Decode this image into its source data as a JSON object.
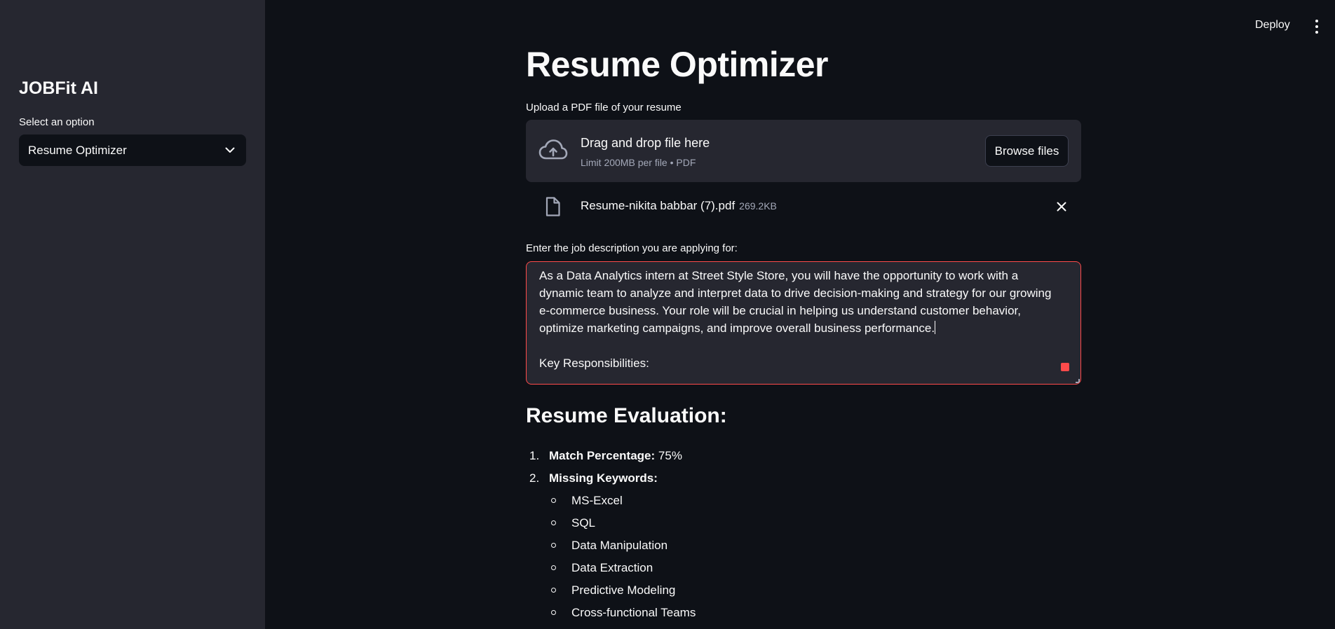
{
  "sidebar": {
    "title": "JOBFit AI",
    "select_label": "Select an option",
    "select_value": "Resume Optimizer"
  },
  "header": {
    "deploy_label": "Deploy"
  },
  "main": {
    "title": "Resume Optimizer",
    "upload": {
      "label": "Upload a PDF file of your resume",
      "drop_title": "Drag and drop file here",
      "drop_subtitle": "Limit 200MB per file • PDF",
      "browse_label": "Browse files"
    },
    "file": {
      "name": "Resume-nikita babbar (7).pdf",
      "size": "269.2KB"
    },
    "job_description": {
      "label": "Enter the job description you are applying for:",
      "paragraph": "As a Data Analytics intern at Street Style Store, you will have the opportunity to work with a dynamic team to analyze and interpret data to drive decision-making and strategy for our growing e-commerce business. Your role will be crucial in helping us understand customer behavior, optimize marketing campaigns, and improve overall business performance.",
      "paragraph2": "Key Responsibilities:"
    },
    "evaluation": {
      "title": "Resume Evaluation:",
      "items": [
        {
          "num": "1.",
          "label": "Match Percentage:",
          "value": "75%"
        },
        {
          "num": "2.",
          "label": "Missing Keywords:",
          "value": ""
        }
      ],
      "missing_keywords": [
        "MS-Excel",
        "SQL",
        "Data Manipulation",
        "Data Extraction",
        "Predictive Modeling",
        "Cross-functional Teams"
      ]
    }
  },
  "colors": {
    "background": "#0e1117",
    "sidebar": "#262730",
    "accent": "#ff4b4b",
    "muted_text": "#a3a8b8"
  }
}
